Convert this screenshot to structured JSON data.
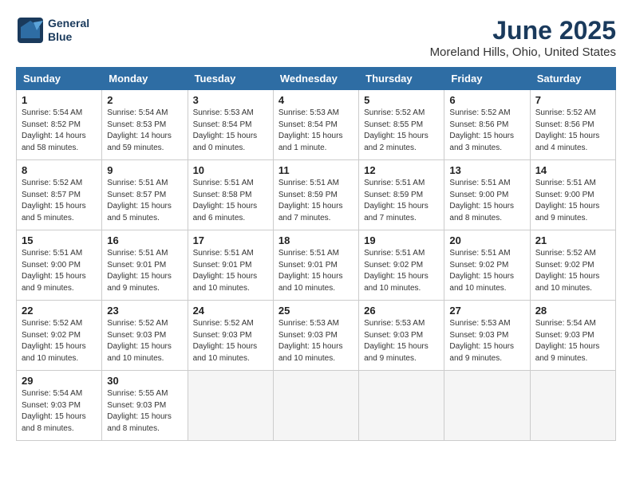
{
  "header": {
    "logo_line1": "General",
    "logo_line2": "Blue",
    "title": "June 2025",
    "subtitle": "Moreland Hills, Ohio, United States"
  },
  "days_of_week": [
    "Sunday",
    "Monday",
    "Tuesday",
    "Wednesday",
    "Thursday",
    "Friday",
    "Saturday"
  ],
  "weeks": [
    [
      {
        "day": "1",
        "info": "Sunrise: 5:54 AM\nSunset: 8:52 PM\nDaylight: 14 hours\nand 58 minutes."
      },
      {
        "day": "2",
        "info": "Sunrise: 5:54 AM\nSunset: 8:53 PM\nDaylight: 14 hours\nand 59 minutes."
      },
      {
        "day": "3",
        "info": "Sunrise: 5:53 AM\nSunset: 8:54 PM\nDaylight: 15 hours\nand 0 minutes."
      },
      {
        "day": "4",
        "info": "Sunrise: 5:53 AM\nSunset: 8:54 PM\nDaylight: 15 hours\nand 1 minute."
      },
      {
        "day": "5",
        "info": "Sunrise: 5:52 AM\nSunset: 8:55 PM\nDaylight: 15 hours\nand 2 minutes."
      },
      {
        "day": "6",
        "info": "Sunrise: 5:52 AM\nSunset: 8:56 PM\nDaylight: 15 hours\nand 3 minutes."
      },
      {
        "day": "7",
        "info": "Sunrise: 5:52 AM\nSunset: 8:56 PM\nDaylight: 15 hours\nand 4 minutes."
      }
    ],
    [
      {
        "day": "8",
        "info": "Sunrise: 5:52 AM\nSunset: 8:57 PM\nDaylight: 15 hours\nand 5 minutes."
      },
      {
        "day": "9",
        "info": "Sunrise: 5:51 AM\nSunset: 8:57 PM\nDaylight: 15 hours\nand 5 minutes."
      },
      {
        "day": "10",
        "info": "Sunrise: 5:51 AM\nSunset: 8:58 PM\nDaylight: 15 hours\nand 6 minutes."
      },
      {
        "day": "11",
        "info": "Sunrise: 5:51 AM\nSunset: 8:59 PM\nDaylight: 15 hours\nand 7 minutes."
      },
      {
        "day": "12",
        "info": "Sunrise: 5:51 AM\nSunset: 8:59 PM\nDaylight: 15 hours\nand 7 minutes."
      },
      {
        "day": "13",
        "info": "Sunrise: 5:51 AM\nSunset: 9:00 PM\nDaylight: 15 hours\nand 8 minutes."
      },
      {
        "day": "14",
        "info": "Sunrise: 5:51 AM\nSunset: 9:00 PM\nDaylight: 15 hours\nand 9 minutes."
      }
    ],
    [
      {
        "day": "15",
        "info": "Sunrise: 5:51 AM\nSunset: 9:00 PM\nDaylight: 15 hours\nand 9 minutes."
      },
      {
        "day": "16",
        "info": "Sunrise: 5:51 AM\nSunset: 9:01 PM\nDaylight: 15 hours\nand 9 minutes."
      },
      {
        "day": "17",
        "info": "Sunrise: 5:51 AM\nSunset: 9:01 PM\nDaylight: 15 hours\nand 10 minutes."
      },
      {
        "day": "18",
        "info": "Sunrise: 5:51 AM\nSunset: 9:01 PM\nDaylight: 15 hours\nand 10 minutes."
      },
      {
        "day": "19",
        "info": "Sunrise: 5:51 AM\nSunset: 9:02 PM\nDaylight: 15 hours\nand 10 minutes."
      },
      {
        "day": "20",
        "info": "Sunrise: 5:51 AM\nSunset: 9:02 PM\nDaylight: 15 hours\nand 10 minutes."
      },
      {
        "day": "21",
        "info": "Sunrise: 5:52 AM\nSunset: 9:02 PM\nDaylight: 15 hours\nand 10 minutes."
      }
    ],
    [
      {
        "day": "22",
        "info": "Sunrise: 5:52 AM\nSunset: 9:02 PM\nDaylight: 15 hours\nand 10 minutes."
      },
      {
        "day": "23",
        "info": "Sunrise: 5:52 AM\nSunset: 9:03 PM\nDaylight: 15 hours\nand 10 minutes."
      },
      {
        "day": "24",
        "info": "Sunrise: 5:52 AM\nSunset: 9:03 PM\nDaylight: 15 hours\nand 10 minutes."
      },
      {
        "day": "25",
        "info": "Sunrise: 5:53 AM\nSunset: 9:03 PM\nDaylight: 15 hours\nand 10 minutes."
      },
      {
        "day": "26",
        "info": "Sunrise: 5:53 AM\nSunset: 9:03 PM\nDaylight: 15 hours\nand 9 minutes."
      },
      {
        "day": "27",
        "info": "Sunrise: 5:53 AM\nSunset: 9:03 PM\nDaylight: 15 hours\nand 9 minutes."
      },
      {
        "day": "28",
        "info": "Sunrise: 5:54 AM\nSunset: 9:03 PM\nDaylight: 15 hours\nand 9 minutes."
      }
    ],
    [
      {
        "day": "29",
        "info": "Sunrise: 5:54 AM\nSunset: 9:03 PM\nDaylight: 15 hours\nand 8 minutes."
      },
      {
        "day": "30",
        "info": "Sunrise: 5:55 AM\nSunset: 9:03 PM\nDaylight: 15 hours\nand 8 minutes."
      },
      {
        "day": "",
        "info": ""
      },
      {
        "day": "",
        "info": ""
      },
      {
        "day": "",
        "info": ""
      },
      {
        "day": "",
        "info": ""
      },
      {
        "day": "",
        "info": ""
      }
    ]
  ]
}
